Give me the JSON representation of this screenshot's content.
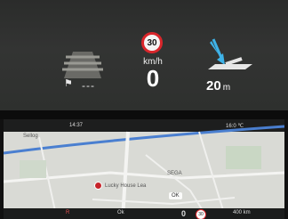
{
  "hud": {
    "lane_gap_text": "---",
    "speed_limit": "30",
    "speed_unit": "km/h",
    "speed": "0",
    "nav_distance": "20",
    "nav_distance_unit": "m"
  },
  "map": {
    "place_top_left": "Sellog",
    "time_left": "14:37",
    "time_right": "16:0 ℃",
    "poi_name": "Lucky House Lea",
    "poi_right": "SEGA",
    "chip_zoom": "OK",
    "bottom": {
      "speed": "0",
      "limit": "30",
      "range": "400 km",
      "gear": "R",
      "label_mid": "Ok"
    }
  },
  "colors": {
    "speed_ring": "#d9262b",
    "turn_arrow": "#3fb3e8",
    "route_blue": "#4a7fd0",
    "map_background": "#d9dad5"
  }
}
